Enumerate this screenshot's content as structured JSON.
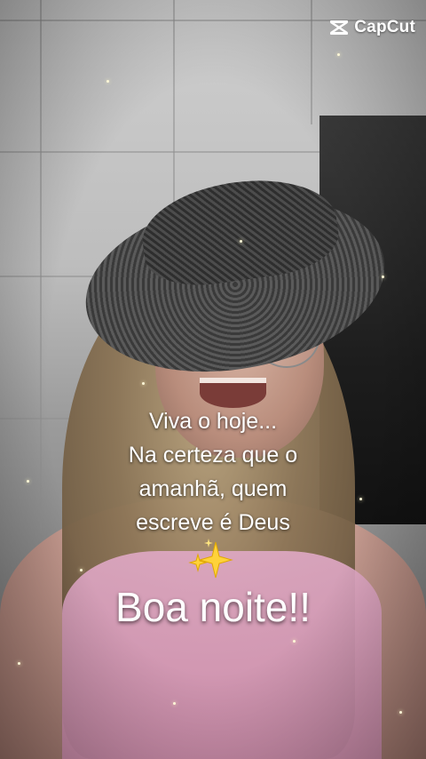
{
  "watermark": {
    "brand": "CapCut",
    "icon": "capcut-logo-icon"
  },
  "caption": {
    "lines": [
      "Viva o hoje...",
      "Na certeza que o",
      "amanhã, quem",
      "escreve é Deus"
    ],
    "emoji_icon": "sparkles-icon",
    "headline": "Boa noite!!"
  },
  "colors": {
    "text": "#ffffff",
    "shirt": "#d592b5"
  }
}
